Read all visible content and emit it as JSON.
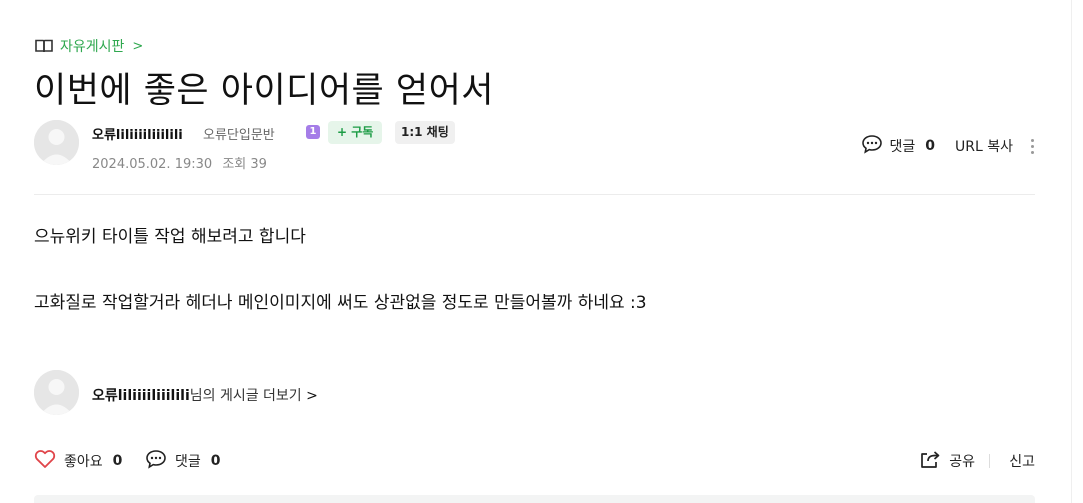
{
  "post": {
    "board": "자유게시판",
    "board_chevron": ">",
    "title": "이번에 좋은 아이디어를 얻어서",
    "author": {
      "nickname": "오류liliiiiliiilili",
      "rank": "오류단입문반",
      "level": "1",
      "subscribe_label": "+ 구독",
      "chat_label": "1:1 채팅"
    },
    "date": "2024.05.02. 19:30",
    "views_label": "조회 39",
    "comments_label": "댓글",
    "comments_count": "0",
    "url_copy_label": "URL 복사",
    "body": [
      "으뉴위키 타이틀 작업 해보려고 합니다",
      "고화질로 작업할거라 헤더나 메인이미지에 써도 상관없을 정도로 만들어볼까 하네요 :3"
    ],
    "more_posts": {
      "nickname": "오류liliiiiliiilili",
      "suffix": "님의 게시글 더보기",
      "chevron": ">"
    },
    "bottom": {
      "like_label": "좋아요",
      "like_count": "0",
      "comment_label": "댓글",
      "comment_count": "0",
      "share_label": "공유",
      "report_label": "신고"
    }
  },
  "colors": {
    "accent_green": "#2fa84f",
    "level_purple": "#a57de8",
    "like_red": "#e0454a"
  },
  "icons": [
    "book-icon",
    "chevron-right-icon",
    "comment-bubble-icon",
    "more-vertical-icon",
    "heart-icon",
    "share-icon"
  ]
}
